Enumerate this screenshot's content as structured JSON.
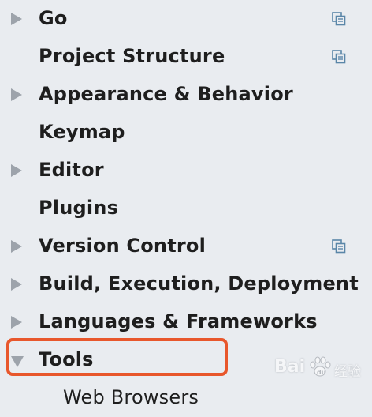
{
  "settings_tree": {
    "items": [
      {
        "label": "Go",
        "arrow": "collapsed",
        "project_icon": true
      },
      {
        "label": "Project Structure",
        "arrow": "none",
        "project_icon": true
      },
      {
        "label": "Appearance & Behavior",
        "arrow": "collapsed",
        "project_icon": false
      },
      {
        "label": "Keymap",
        "arrow": "none",
        "project_icon": false
      },
      {
        "label": "Editor",
        "arrow": "collapsed",
        "project_icon": false
      },
      {
        "label": "Plugins",
        "arrow": "none",
        "project_icon": false
      },
      {
        "label": "Version Control",
        "arrow": "collapsed",
        "project_icon": true
      },
      {
        "label": "Build, Execution, Deployment",
        "arrow": "collapsed",
        "project_icon": false
      },
      {
        "label": "Languages & Frameworks",
        "arrow": "collapsed",
        "project_icon": false
      },
      {
        "label": "Tools",
        "arrow": "expanded",
        "project_icon": false
      }
    ],
    "child_items": [
      {
        "label": "Web Browsers"
      }
    ]
  },
  "annotation": {
    "highlight_color": "#e8572c",
    "highlighted_item": "Tools"
  },
  "watermark": {
    "brand": "Bai",
    "brand_suffix": "du",
    "sub": "经验"
  },
  "colors": {
    "background": "#e9ecf0",
    "arrow": "#9da3ab",
    "text": "#1e1e1e",
    "icon": "#5a86a8"
  }
}
